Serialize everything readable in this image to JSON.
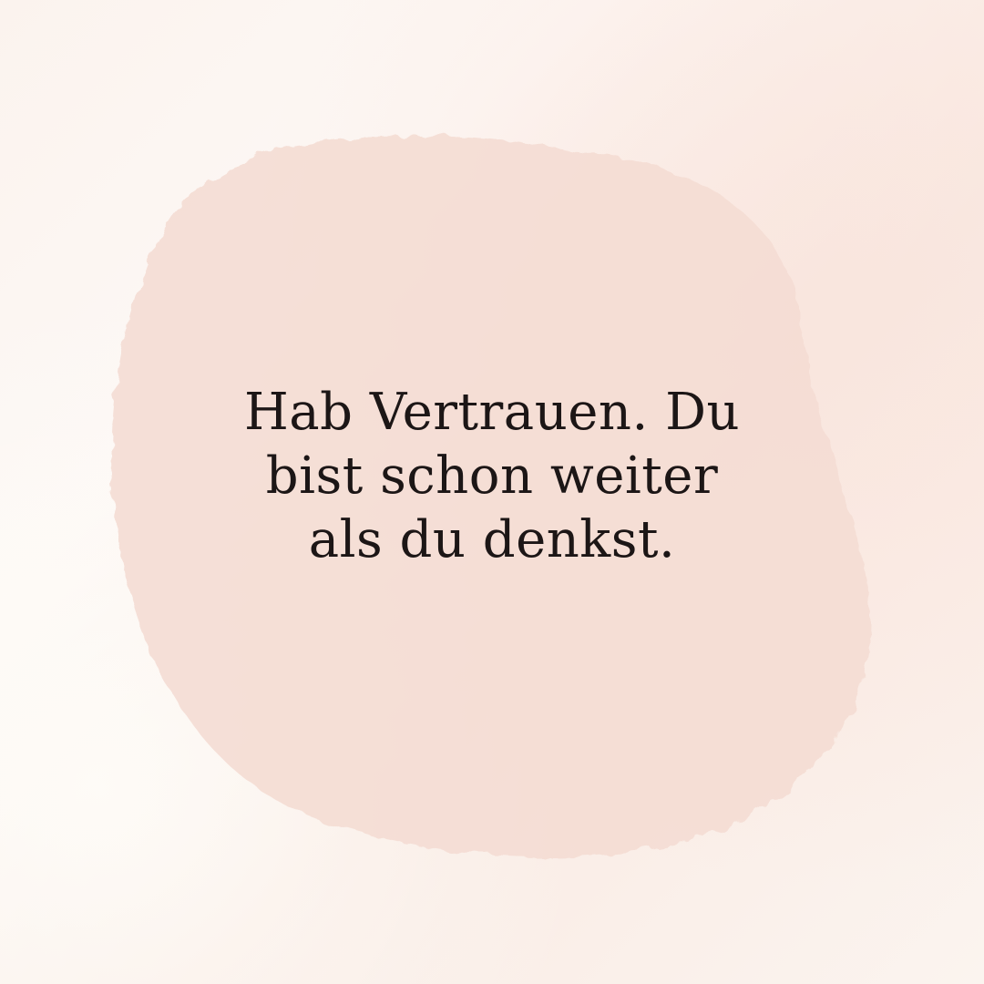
{
  "quote": {
    "lines": [
      "Hab Vertrauen. Du",
      "bist schon weiter",
      "als du denkst."
    ]
  },
  "colors": {
    "background": "#fbf3ee",
    "blob": "#f5ddd4",
    "text": "#1c1616"
  }
}
